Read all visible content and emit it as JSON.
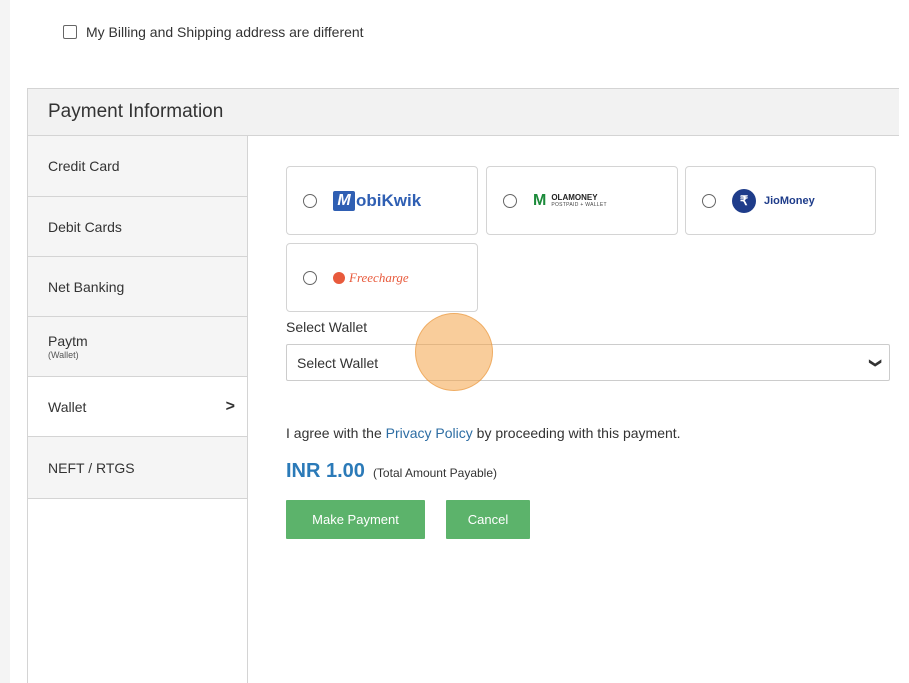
{
  "billing": {
    "checkbox_label": "My Billing and Shipping address are different",
    "checked": false
  },
  "panel": {
    "title": "Payment Information"
  },
  "sidebar": {
    "items": [
      {
        "label": "Credit Card",
        "sub": ""
      },
      {
        "label": "Debit Cards",
        "sub": ""
      },
      {
        "label": "Net Banking",
        "sub": ""
      },
      {
        "label": "Paytm",
        "sub": "(Wallet)"
      },
      {
        "label": "Wallet",
        "sub": "",
        "active": true,
        "chevron": ">"
      },
      {
        "label": "NEFT / RTGS",
        "sub": ""
      }
    ]
  },
  "wallets": [
    {
      "id": "mobikwik",
      "mark": "M",
      "name": "obiKwik"
    },
    {
      "id": "olamoney",
      "mark": "M",
      "name_line1": "OLAMONEY",
      "name_line2": "POSTPAID + WALLET"
    },
    {
      "id": "jiomoney",
      "mark": "₹",
      "name": "JioMoney"
    },
    {
      "id": "freecharge",
      "name": "Freecharge"
    }
  ],
  "select": {
    "label": "Select Wallet",
    "value": "Select Wallet"
  },
  "agreement": {
    "prefix": "I agree with the ",
    "link": "Privacy Policy",
    "suffix": " by proceeding with this payment."
  },
  "amount": {
    "value": "INR 1.00",
    "note": "(Total Amount Payable)"
  },
  "buttons": {
    "pay": "Make Payment",
    "cancel": "Cancel"
  },
  "colors": {
    "accent_green": "#5cb36b",
    "amount_blue": "#2b7ab8",
    "link_blue": "#2d6da3",
    "highlight": "#f4a448"
  }
}
